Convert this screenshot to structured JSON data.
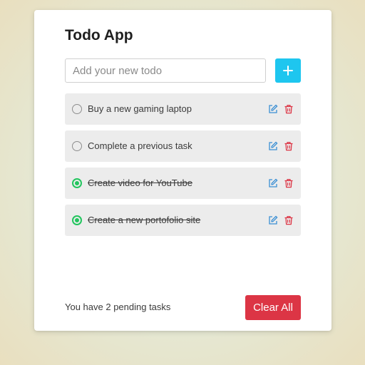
{
  "app": {
    "title": "Todo App"
  },
  "input": {
    "placeholder": "Add your new todo",
    "value": ""
  },
  "add_button": {
    "icon": "plus-icon",
    "color": "#1ec6ef"
  },
  "todos": [
    {
      "text": "Buy a new gaming laptop",
      "completed": false
    },
    {
      "text": "Complete a previous task",
      "completed": false
    },
    {
      "text": "Create video for YouTube",
      "completed": true
    },
    {
      "text": "Create a new portofolio site",
      "completed": true
    }
  ],
  "item_icons": {
    "edit": "edit-icon",
    "delete": "trash-icon",
    "edit_color": "#3b8fd4",
    "delete_color": "#dc3545",
    "done_color": "#22c55e"
  },
  "footer": {
    "pending_text": "You have 2 pending tasks",
    "clear_label": "Clear All",
    "clear_color": "#dc3545"
  }
}
